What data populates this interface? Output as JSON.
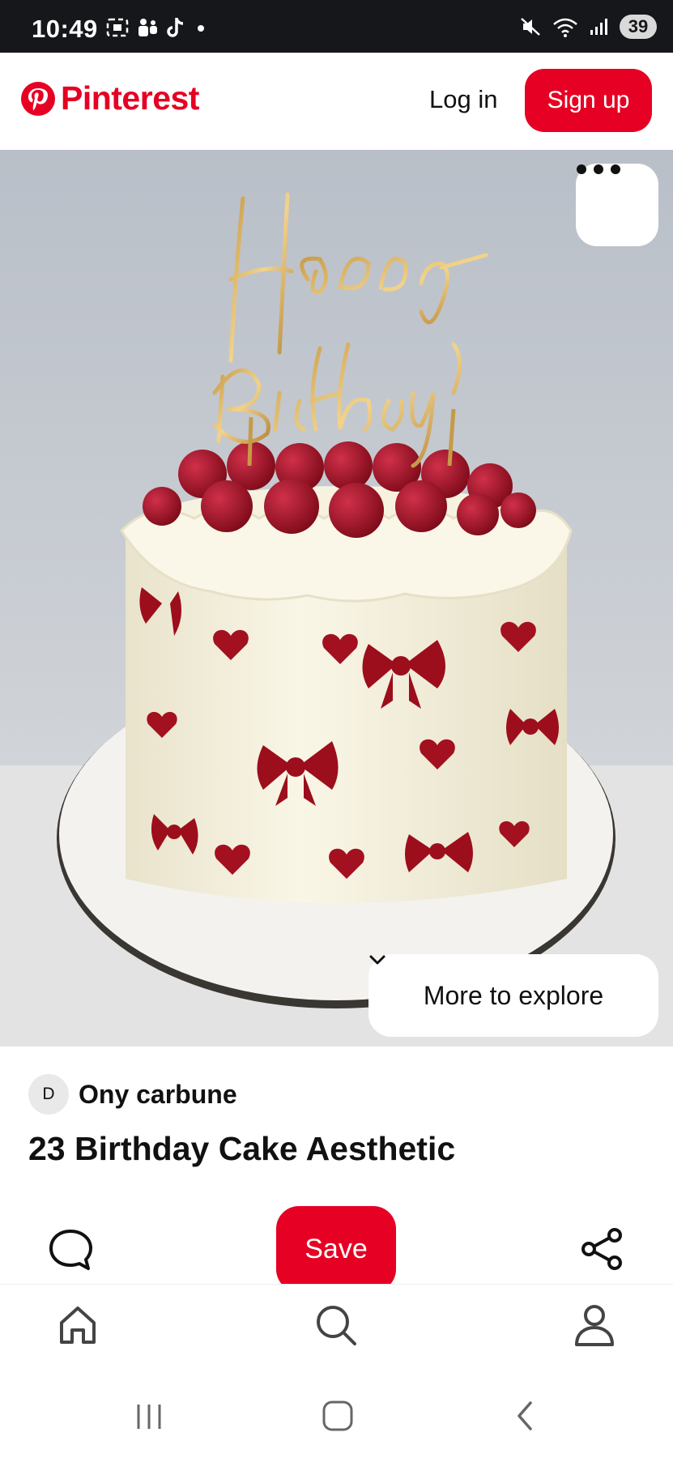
{
  "status_bar": {
    "time": "10:49",
    "battery": "39",
    "left_icons": [
      "screenshot-icon",
      "teams-icon",
      "tiktok-icon",
      "notification-dot-icon"
    ],
    "right_icons": [
      "mute-icon",
      "wifi-icon",
      "signal-icon",
      "battery-icon"
    ]
  },
  "header": {
    "brand": "Pinterest",
    "login_label": "Log in",
    "signup_label": "Sign up"
  },
  "pin": {
    "image_alt": "cake-photo",
    "topper_text": [
      "Happy",
      "Birthday"
    ],
    "more_to_explore_label": "More to explore",
    "author_initial": "D",
    "author_name": "Ony carbune",
    "title": "23 Birthday Cake Aesthetic",
    "save_label": "Save"
  },
  "bottom_nav": {
    "items": [
      "home-icon",
      "search-icon",
      "profile-icon"
    ]
  },
  "system_nav": {
    "items": [
      "recents-icon",
      "home-button-icon",
      "back-icon"
    ]
  },
  "colors": {
    "brand_red": "#e60023",
    "status_bar": "#16171b",
    "cake_cream": "#f6f1e0",
    "berry_red": "#a3101f"
  }
}
